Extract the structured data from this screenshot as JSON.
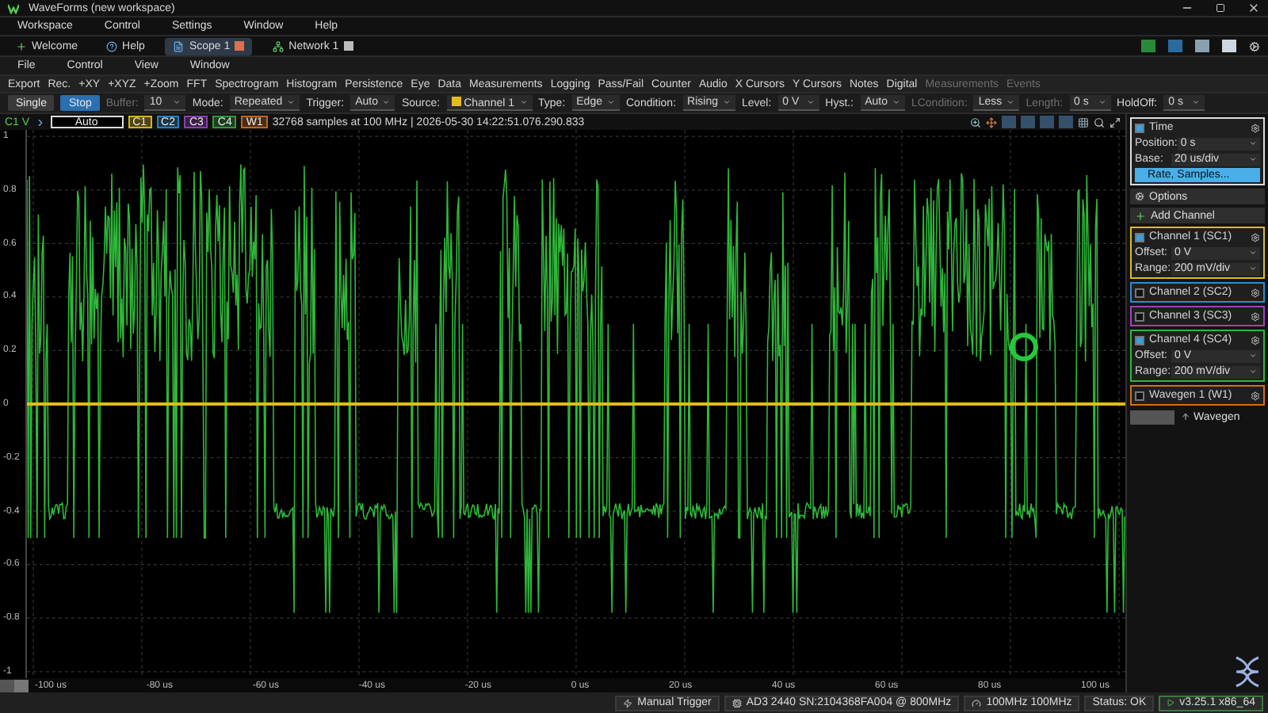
{
  "window": {
    "title": "WaveForms (new workspace)"
  },
  "menu": [
    "Workspace",
    "Control",
    "Settings",
    "Window",
    "Help"
  ],
  "tabs": [
    {
      "label": "Welcome",
      "kind": "home",
      "selected": false
    },
    {
      "label": "Help",
      "kind": "help",
      "selected": false
    },
    {
      "label": "Scope 1",
      "kind": "scope",
      "selected": true
    },
    {
      "label": "Network 1",
      "kind": "network",
      "selected": false
    }
  ],
  "submenu": [
    "File",
    "Control",
    "View",
    "Window"
  ],
  "tools": [
    {
      "label": "Export",
      "disabled": false
    },
    {
      "label": "Rec.",
      "disabled": false
    },
    {
      "label": "+XY",
      "disabled": false
    },
    {
      "label": "+XYZ",
      "disabled": false
    },
    {
      "label": "+Zoom",
      "disabled": false
    },
    {
      "label": "FFT",
      "disabled": false
    },
    {
      "label": "Spectrogram",
      "disabled": false
    },
    {
      "label": "Histogram",
      "disabled": false
    },
    {
      "label": "Persistence",
      "disabled": false
    },
    {
      "label": "Eye",
      "disabled": false
    },
    {
      "label": "Data",
      "disabled": false
    },
    {
      "label": "Measurements",
      "disabled": false
    },
    {
      "label": "Logging",
      "disabled": false
    },
    {
      "label": "Pass/Fail",
      "disabled": false
    },
    {
      "label": "Counter",
      "disabled": false
    },
    {
      "label": "Audio",
      "disabled": false
    },
    {
      "label": "X Cursors",
      "disabled": false
    },
    {
      "label": "Y Cursors",
      "disabled": false
    },
    {
      "label": "Notes",
      "disabled": false
    },
    {
      "label": "Digital",
      "disabled": false
    },
    {
      "label": "Measurements",
      "disabled": true
    },
    {
      "label": "Events",
      "disabled": true
    }
  ],
  "controls": [
    {
      "kind": "button",
      "label": "Single",
      "selected": false
    },
    {
      "kind": "button",
      "label": "Stop",
      "selected": true
    },
    {
      "kind": "select",
      "label": "Buffer:",
      "value": "10",
      "disabled": true
    },
    {
      "kind": "select",
      "label": "Mode:",
      "value": "Repeated",
      "disabled": false
    },
    {
      "kind": "select",
      "label": "Trigger:",
      "value": "Auto",
      "disabled": false
    },
    {
      "kind": "select",
      "label": "Source:",
      "value": "Channel 1",
      "disabled": false
    },
    {
      "kind": "select",
      "label": "Type:",
      "value": "Edge",
      "disabled": false
    },
    {
      "kind": "select",
      "label": "Condition:",
      "value": "Rising",
      "disabled": false
    },
    {
      "kind": "select",
      "label": "Level:",
      "value": "0 V",
      "disabled": false
    },
    {
      "kind": "select",
      "label": "Hyst.:",
      "value": "Auto",
      "disabled": false
    },
    {
      "kind": "select",
      "label": "LCondition:",
      "value": "Less",
      "disabled": true
    },
    {
      "kind": "select",
      "label": "Length:",
      "value": "0 s",
      "disabled": true
    },
    {
      "kind": "select",
      "label": "HoldOff:",
      "value": "0 s",
      "disabled": false
    }
  ],
  "info": {
    "axis": "C1 V",
    "mode": "Auto",
    "chips": [
      {
        "label": "C1",
        "color": "#d4b21c"
      },
      {
        "label": "C2",
        "color": "#2a7fc0"
      },
      {
        "label": "C3",
        "color": "#8a3fb0"
      },
      {
        "label": "C4",
        "color": "#2f9a3a"
      },
      {
        "label": "W1",
        "color": "#c0661c"
      }
    ],
    "text": "32768 samples at 100 MHz | 2026-05-30 14:22:51.076.290.833"
  },
  "plot": {
    "y_labels": [
      "1",
      "0.8",
      "0.6",
      "0.4",
      "0.2",
      "0",
      "-0.2",
      "-0.4",
      "-0.6",
      "-0.8",
      "-1"
    ],
    "x_labels": [
      "-100 us",
      "-80 us",
      "-60 us",
      "-40 us",
      "-20 us",
      "0 us",
      "20 us",
      "40 us",
      "60 us",
      "80 us",
      "100 us"
    ]
  },
  "time": {
    "title": "Time",
    "checked": true,
    "fields": [
      {
        "label": "Position:",
        "value": "0 s"
      },
      {
        "label": "Base:",
        "value": "20 us/div"
      }
    ],
    "button": "Rate, Samples..."
  },
  "options": "Options",
  "add_channel": "Add Channel",
  "channels": [
    {
      "name": "Channel 1 (SC1)",
      "color": "#e0bc1c",
      "enabled": true,
      "kind": "flat",
      "fields": [
        {
          "label": "Offset:",
          "value": "0 V"
        },
        {
          "label": "Range:",
          "value": "200 mV/div"
        }
      ]
    },
    {
      "name": "Channel 2 (SC2)",
      "color": "#2a8fd0",
      "enabled": false
    },
    {
      "name": "Channel 3 (SC3)",
      "color": "#a040c0",
      "enabled": false
    },
    {
      "name": "Channel 4 (SC4)",
      "color": "#2fb83a",
      "enabled": true,
      "kind": "burst",
      "fields": [
        {
          "label": "Offset:",
          "value": "0 V"
        },
        {
          "label": "Range:",
          "value": "200 mV/div"
        }
      ]
    }
  ],
  "wavegen": {
    "name": "Wavegen 1 (W1)",
    "color": "#d0701c",
    "enabled": false
  },
  "footer": {
    "link": "Wavegen"
  },
  "status": [
    "Manual Trigger",
    "AD3 2440 SN:2104368FA004 @ 800MHz",
    "100MHz 100MHz",
    "Status: OK",
    "v3.25.1 x86_64"
  ]
}
